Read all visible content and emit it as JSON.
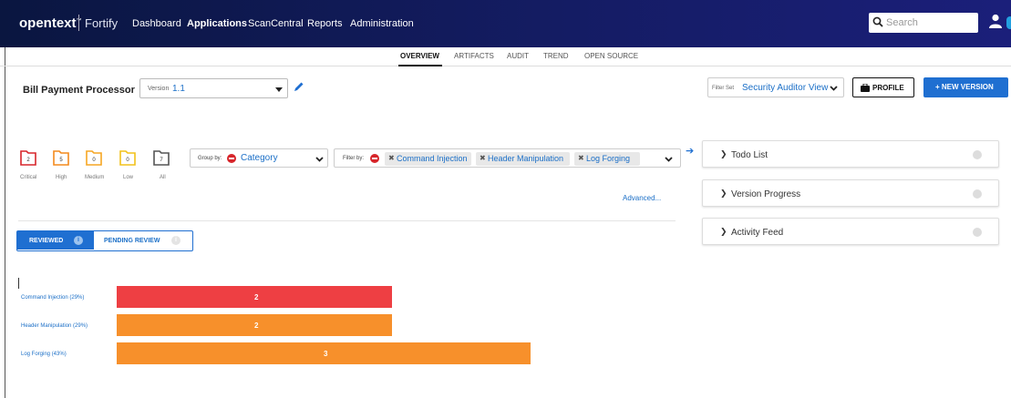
{
  "topbar": {
    "brand": "opentext",
    "brand_tm": "™",
    "product": "Fortify",
    "nav": [
      "Dashboard",
      "Applications",
      "ScanCentral",
      "Reports",
      "Administration"
    ],
    "active_nav": "Applications",
    "search_placeholder": "Search",
    "colors": {
      "bg_start": "#0a1640",
      "bg_end": "#1b1f7a"
    }
  },
  "tabs": [
    "OVERVIEW",
    "ARTIFACTS",
    "AUDIT",
    "TREND",
    "OPEN SOURCE"
  ],
  "active_tab": "OVERVIEW",
  "app": {
    "title": "Bill Payment Processor",
    "version_label": "Version",
    "version_value": "1.1"
  },
  "actions": {
    "filter_set_label": "Filter Set",
    "filter_set_value": "Security Auditor View",
    "profile_label": "PROFILE",
    "new_version_label": "+ NEW VERSION"
  },
  "folders": [
    {
      "count": "2",
      "label": "Critical",
      "color": "#d7262b"
    },
    {
      "count": "5",
      "label": "High",
      "color": "#f38a1d"
    },
    {
      "count": "0",
      "label": "Medium",
      "color": "#f6a623"
    },
    {
      "count": "0",
      "label": "Low",
      "color": "#f2c21b"
    },
    {
      "count": "7",
      "label": "All",
      "color": "#555555"
    }
  ],
  "group_by": {
    "label": "Group by:",
    "value": "Category"
  },
  "filter_by": {
    "label": "Filter by:",
    "chips": [
      "Command Injection",
      "Header Manipulation",
      "Log Forging"
    ]
  },
  "advanced_link": "Advanced...",
  "review_toggle": {
    "reviewed": "REVIEWED",
    "pending": "PENDING REVIEW"
  },
  "chart_data": {
    "type": "bar",
    "orientation": "horizontal",
    "categories": [
      "Command Injection (29%)",
      "Header Manipulation (29%)",
      "Log Forging (43%)"
    ],
    "values": [
      2,
      2,
      3
    ],
    "colors": [
      "#ee3f43",
      "#f7902b",
      "#f7902b"
    ],
    "xlim": [
      0,
      3
    ]
  },
  "panels": [
    "Todo List",
    "Version Progress",
    "Activity Feed"
  ]
}
